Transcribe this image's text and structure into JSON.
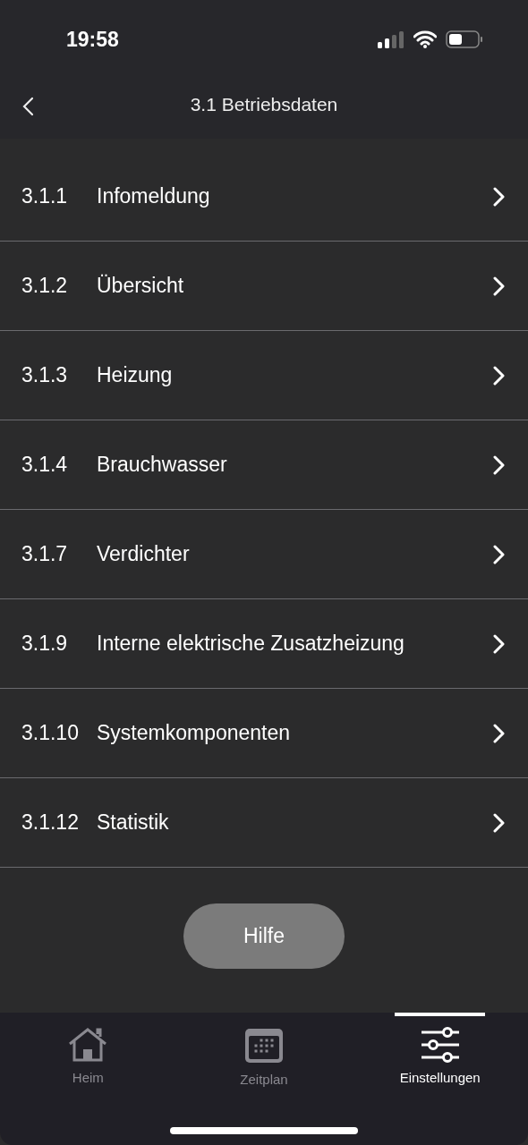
{
  "status_bar": {
    "time": "19:58"
  },
  "header": {
    "title": "3.1 Betriebsdaten"
  },
  "items": [
    {
      "number": "3.1.1",
      "label": "Infomeldung"
    },
    {
      "number": "3.1.2",
      "label": "Übersicht"
    },
    {
      "number": "3.1.3",
      "label": "Heizung"
    },
    {
      "number": "3.1.4",
      "label": "Brauchwasser"
    },
    {
      "number": "3.1.7",
      "label": "Verdichter"
    },
    {
      "number": "3.1.9",
      "label": "Interne elektrische Zusatzheizung"
    },
    {
      "number": "3.1.10",
      "label": "Systemkomponenten"
    },
    {
      "number": "3.1.12",
      "label": "Statistik"
    }
  ],
  "help_button": "Hilfe",
  "tabs": [
    {
      "label": "Heim",
      "kind": "home",
      "selected": false
    },
    {
      "label": "Zeitplan",
      "kind": "calendar",
      "selected": false
    },
    {
      "label": "Einstellungen",
      "kind": "settings",
      "selected": true
    }
  ]
}
